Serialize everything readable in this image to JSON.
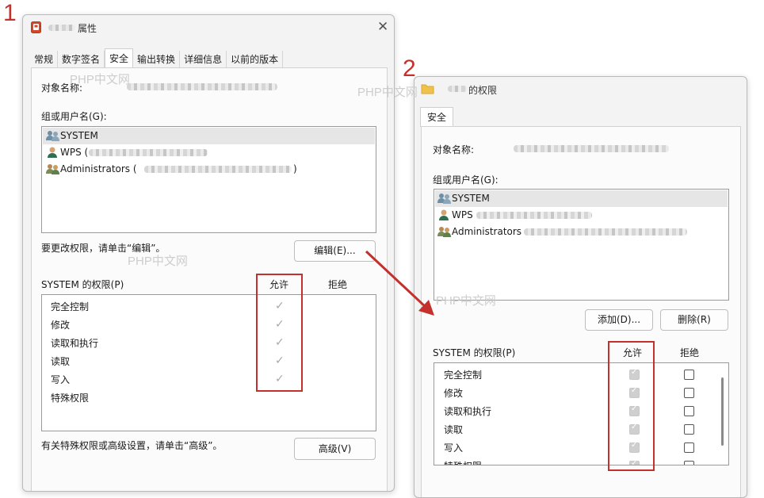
{
  "annotations": {
    "num1": "1",
    "num2": "2"
  },
  "watermark": "PHP中文网",
  "dialog1": {
    "title": "属性",
    "tabs": [
      "常规",
      "数字签名",
      "安全",
      "输出转换",
      "详细信息",
      "以前的版本"
    ],
    "object_label": "对象名称:",
    "groups_label": "组或用户名(G):",
    "users": [
      "SYSTEM",
      "WPS (",
      "Administrators ("
    ],
    "users_suffix_admin": ")",
    "change_hint": "要更改权限，请单击“编辑”。",
    "edit_button": "编辑(E)...",
    "perm_title": "SYSTEM 的权限(P)",
    "allow_label": "允许",
    "deny_label": "拒绝",
    "permissions": [
      "完全控制",
      "修改",
      "读取和执行",
      "读取",
      "写入",
      "特殊权限"
    ],
    "advanced_hint": "有关特殊权限或高级设置，请单击“高级”。",
    "advanced_button": "高级(V)"
  },
  "dialog2": {
    "title": "的权限",
    "tab": "安全",
    "object_label": "对象名称:",
    "groups_label": "组或用户名(G):",
    "users": [
      "SYSTEM",
      "WPS",
      "Administrators"
    ],
    "add_button": "添加(D)...",
    "remove_button": "删除(R)",
    "perm_title": "SYSTEM 的权限(P)",
    "allow_label": "允许",
    "deny_label": "拒绝",
    "permissions": [
      "完全控制",
      "修改",
      "读取和执行",
      "读取",
      "写入",
      "特殊权限"
    ]
  },
  "colors": {
    "annotation_red": "#c4302b",
    "dialog_bg": "#f3f3f3",
    "checkmark_gray": "#a8a8a8"
  },
  "icons": [
    "pptx-file-icon",
    "close-icon",
    "user-group-icon",
    "user-icon",
    "folder-icon",
    "checkmark-icon",
    "arrow-annotation"
  ]
}
